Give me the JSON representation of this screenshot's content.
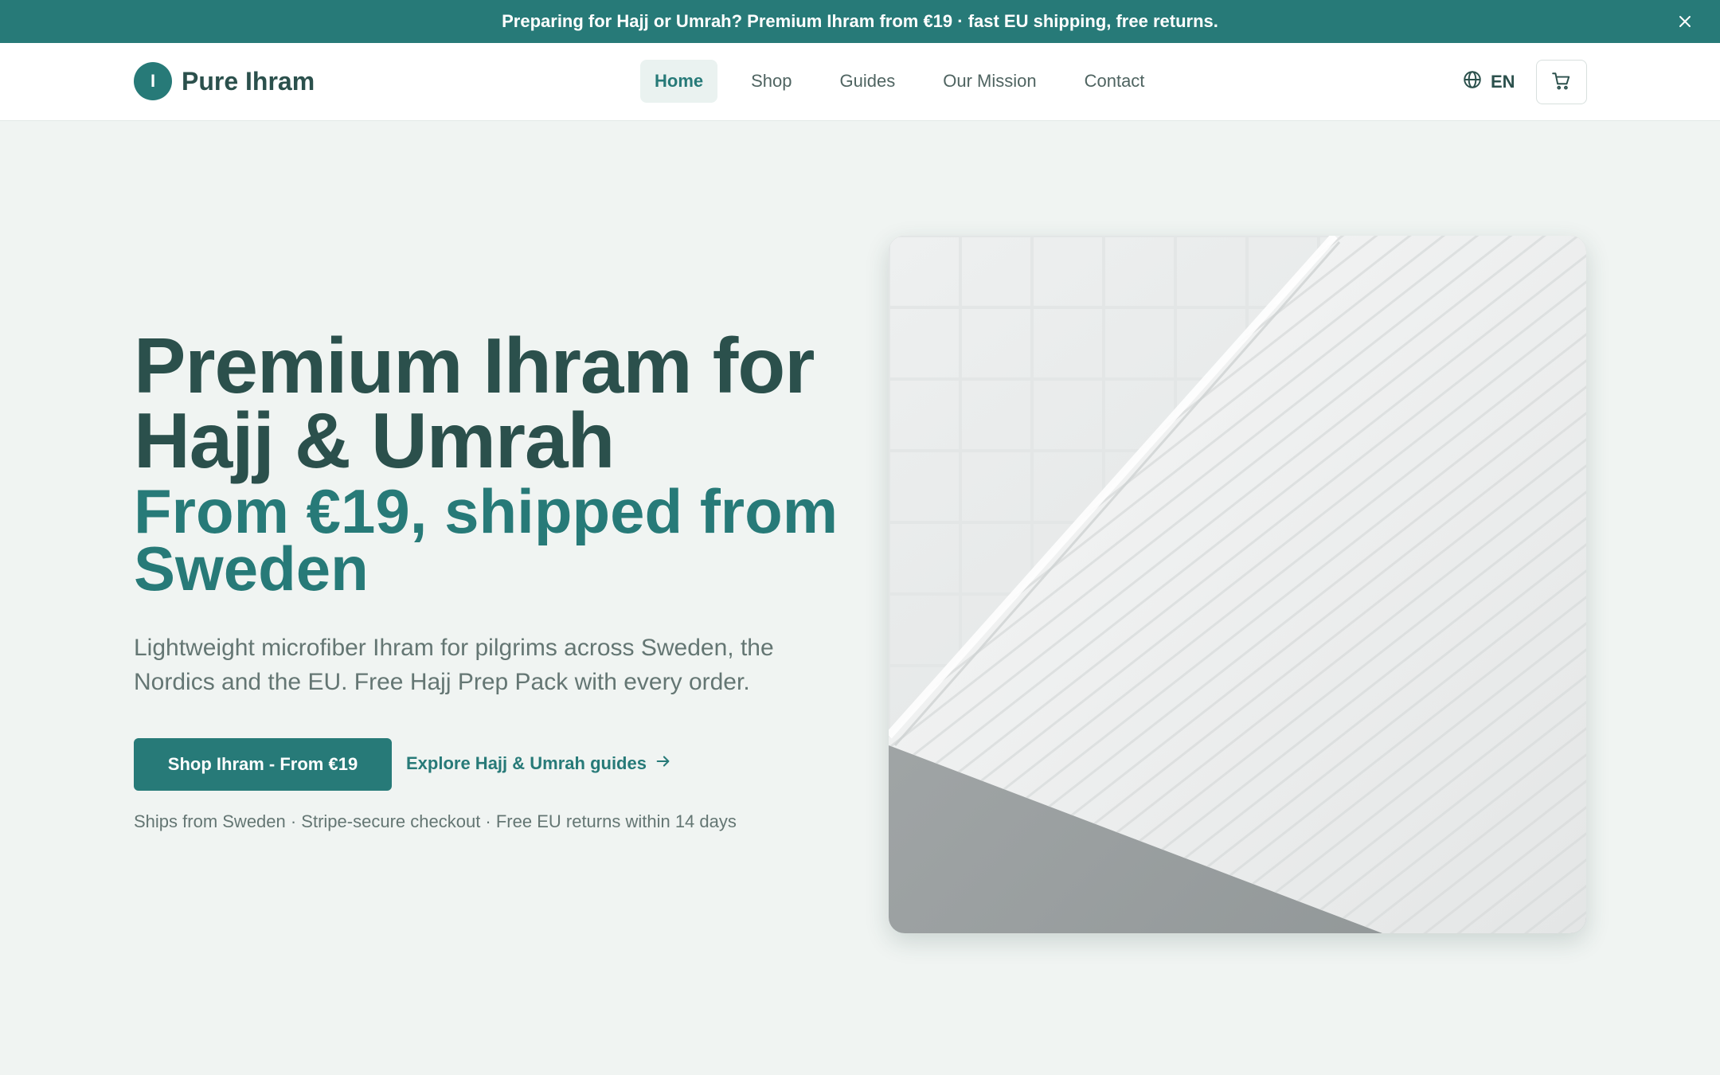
{
  "announcement": {
    "text": "Preparing for Hajj or Umrah? Premium Ihram from €19 · fast EU shipping, free returns.",
    "close_icon": "close-icon"
  },
  "header": {
    "logo_letter": "I",
    "brand": "Pure Ihram",
    "nav": [
      {
        "label": "Home",
        "active": true
      },
      {
        "label": "Shop",
        "active": false
      },
      {
        "label": "Guides",
        "active": false
      },
      {
        "label": "Our Mission",
        "active": false
      },
      {
        "label": "Contact",
        "active": false
      }
    ],
    "language": {
      "icon": "globe-icon",
      "label": "EN"
    },
    "cart_icon": "cart-icon"
  },
  "hero": {
    "title": "Premium Ihram for Hajj & Umrah",
    "subtitle": "From €19, shipped from Sweden",
    "description": "Lightweight microfiber Ihram for pilgrims across Sweden, the Nordics and the EU. Free Hajj Prep Pack with every order.",
    "primary_cta": "Shop Ihram - From €19",
    "secondary_cta": "Explore Hajj & Umrah guides",
    "secondary_cta_icon": "arrow-right-icon",
    "trust_line": "Ships from Sweden · Stripe-secure checkout · Free EU returns within 14 days"
  },
  "colors": {
    "accent": "#277a78",
    "heading": "#2b504c",
    "background": "#f0f4f2",
    "body_text": "#647673"
  }
}
